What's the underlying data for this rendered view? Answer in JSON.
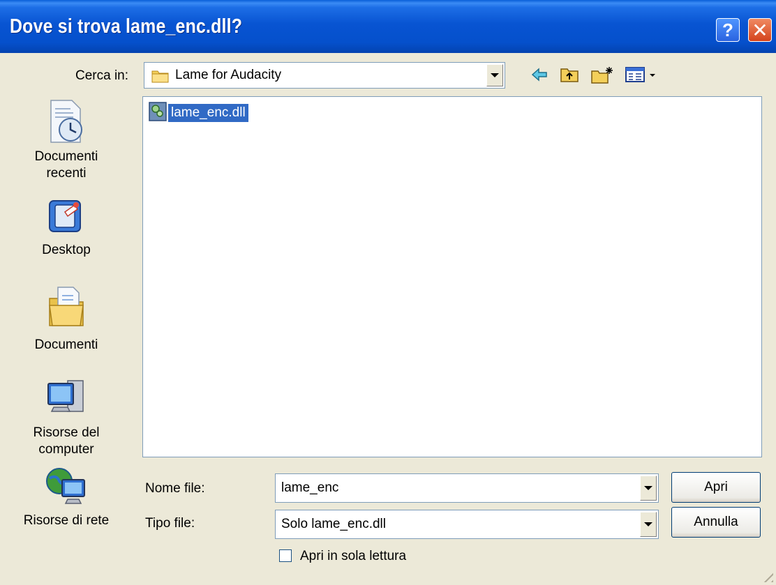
{
  "window": {
    "title": "Dove si trova lame_enc.dll?",
    "help_label": "?",
    "close_label": "✕"
  },
  "look_in": {
    "label": "Cerca in:",
    "value": "Lame for Audacity",
    "icon": "folder-icon"
  },
  "toolbar": {
    "icons": [
      "back-arrow-icon",
      "up-folder-icon",
      "new-folder-icon",
      "view-menu-icon"
    ]
  },
  "places": [
    {
      "label": "Documenti recenti",
      "line1": "Documenti",
      "line2": "recenti",
      "icon": "recent-documents-icon"
    },
    {
      "label": "Desktop",
      "line1": "Desktop",
      "line2": "",
      "icon": "desktop-icon"
    },
    {
      "label": "Documenti",
      "line1": "Documenti",
      "line2": "",
      "icon": "my-documents-icon"
    },
    {
      "label": "Risorse del computer",
      "line1": "Risorse del",
      "line2": "computer",
      "icon": "my-computer-icon"
    },
    {
      "label": "Risorse di rete",
      "line1": "Risorse di rete",
      "line2": "",
      "icon": "network-places-icon"
    }
  ],
  "files": [
    {
      "name": "lame_enc.dll",
      "selected": true,
      "icon": "dll-file-icon"
    }
  ],
  "filename": {
    "label": "Nome file:",
    "value": "lame_enc"
  },
  "filetype": {
    "label": "Tipo file:",
    "value": "Solo lame_enc.dll"
  },
  "buttons": {
    "open": "Apri",
    "cancel": "Annulla"
  },
  "readonly": {
    "label": "Apri in sola lettura",
    "checked": false
  },
  "colors": {
    "titlebar": "#0854d2",
    "selection": "#316ac5",
    "dialog_bg": "#ece9d8"
  }
}
